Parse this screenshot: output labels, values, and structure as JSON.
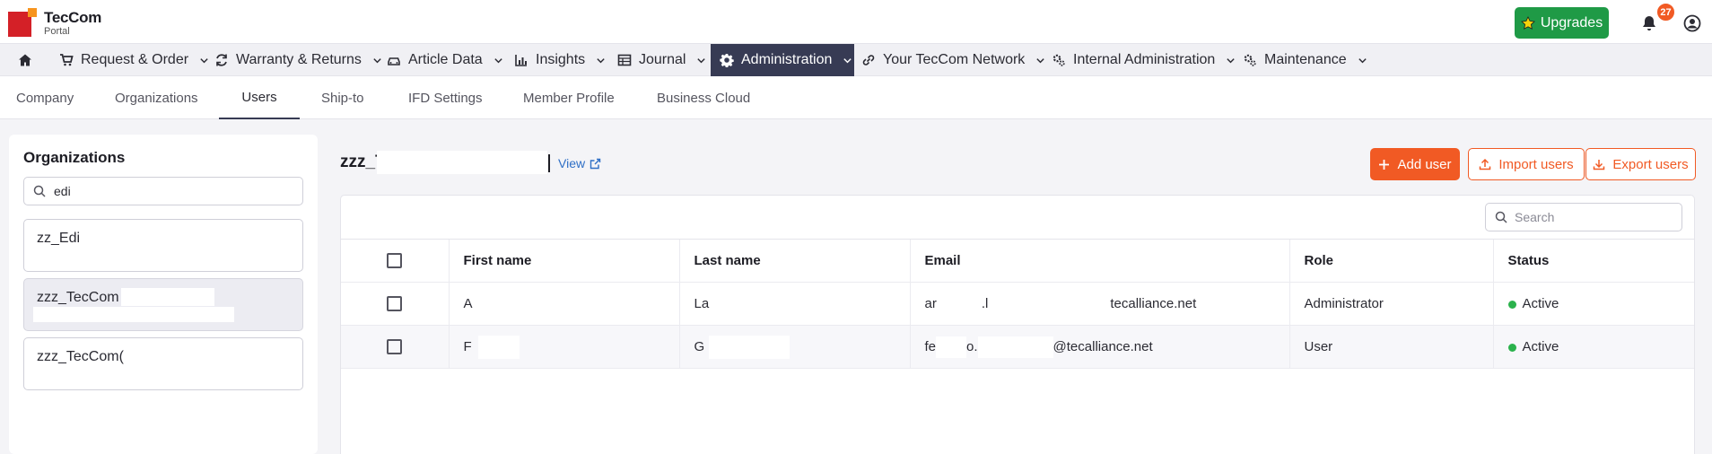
{
  "app": {
    "logo_name": "TecCom",
    "logo_sub": "Portal",
    "upgrades_label": "Upgrades",
    "notification_count": "27",
    "brand_color": "#f15a24",
    "upgrade_color": "#1f9a46"
  },
  "nav": {
    "items": [
      {
        "label": "Request & Order",
        "icon": "cart-icon"
      },
      {
        "label": "Warranty & Returns",
        "icon": "refresh-icon"
      },
      {
        "label": "Article Data",
        "icon": "car-icon"
      },
      {
        "label": "Insights",
        "icon": "chart-icon"
      },
      {
        "label": "Journal",
        "icon": "table-icon"
      },
      {
        "label": "Administration",
        "icon": "gear-icon",
        "active": true
      },
      {
        "label": "Your TecCom Network",
        "icon": "link-icon"
      },
      {
        "label": "Internal Administration",
        "icon": "gears-icon"
      },
      {
        "label": "Maintenance",
        "icon": "gears-icon"
      }
    ]
  },
  "subtabs": [
    "Company",
    "Organizations",
    "Users",
    "Ship-to",
    "IFD Settings",
    "Member Profile",
    "Business Cloud"
  ],
  "active_subtab": "Users",
  "organizations": {
    "title": "Organizations",
    "search_value": "edi",
    "items": [
      "zz_Edi",
      "zzz_TecCom",
      "zzz_TecCom("
    ],
    "selected_index": 1
  },
  "main": {
    "org_name": "zzz_T",
    "view_label": "View",
    "add_user_label": "Add user",
    "import_label": "Import users",
    "export_label": "Export users",
    "search_placeholder": "Search"
  },
  "table": {
    "columns": [
      "First name",
      "Last name",
      "Email",
      "Role",
      "Status"
    ],
    "rows": [
      {
        "first": "A",
        "last": "La",
        "email_a": "ar",
        "email_b": ".l",
        "email_c": "tecalliance.net",
        "role": "Administrator",
        "status": "Active"
      },
      {
        "first": "F",
        "last": "G",
        "email_a": "fe",
        "email_b": "o.",
        "email_c": "@tecalliance.net",
        "role": "User",
        "status": "Active"
      }
    ]
  }
}
